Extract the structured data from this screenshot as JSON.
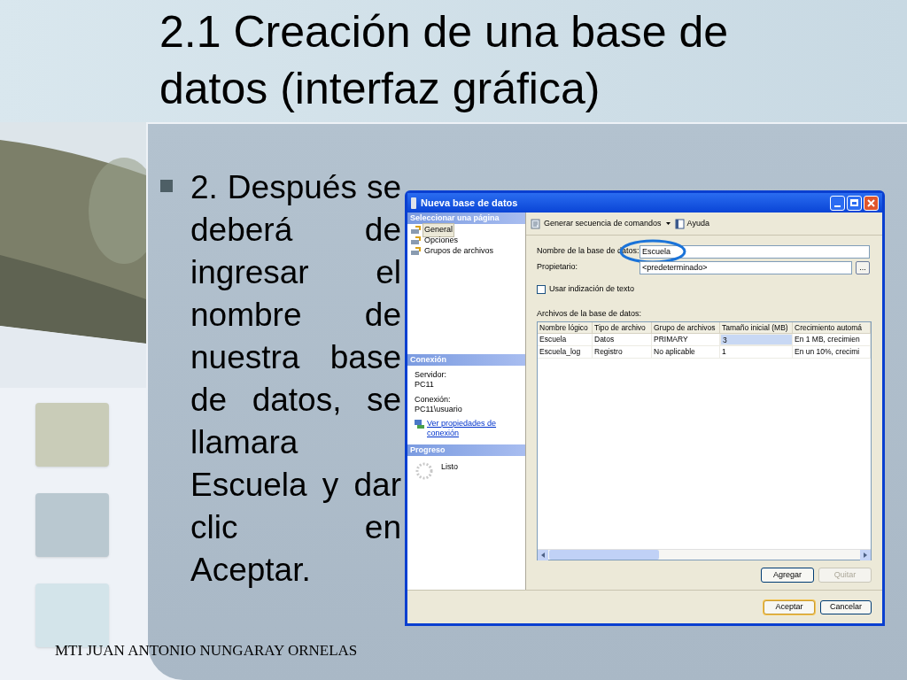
{
  "slide": {
    "title": "2.1 Creación de una base de datos (interfaz gráfica)",
    "bullet": "2. Después se deberá de ingresar el nombre de nuestra base de datos, se llamara Escuela y dar clic en Aceptar.",
    "footer": "MTI JUAN ANTONIO NUNGARAY ORNELAS"
  },
  "dialog": {
    "title": "Nueva base de datos",
    "pages_header": "Seleccionar una página",
    "pages": [
      {
        "label": "General",
        "selected": true
      },
      {
        "label": "Opciones",
        "selected": false
      },
      {
        "label": "Grupos de archivos",
        "selected": false
      }
    ],
    "connection": {
      "header": "Conexión",
      "server_label": "Servidor:",
      "server": "PC11",
      "connection_label": "Conexión:",
      "connection": "PC11\\usuario",
      "link": "Ver propiedades de conexión"
    },
    "progress": {
      "header": "Progreso",
      "status": "Listo"
    },
    "script_button": "Generar secuencia de comandos",
    "help_button": "Ayuda",
    "fields": [
      {
        "label": "Nombre de la base de datos:",
        "value": "Escuela"
      },
      {
        "label": "Propietario:",
        "value": "<predeterminado>",
        "browse_button": "..."
      }
    ],
    "fulltext": {
      "label": "Usar indización de texto",
      "checked": false
    },
    "files": {
      "label": "Archivos de la base de datos:",
      "columns": [
        "Nombre lógico",
        "Tipo de archivo",
        "Grupo de archivos",
        "Tamaño inicial (MB)",
        "Crecimiento automá"
      ],
      "rows": [
        {
          "cells": [
            {
              "text": "Escuela",
              "selected": false
            },
            {
              "text": "Datos",
              "selected": false
            },
            {
              "text": "PRIMARY",
              "selected": false
            },
            {
              "text": "3",
              "selected": true
            },
            {
              "text": "En 1 MB, crecimien",
              "selected": false
            }
          ]
        },
        {
          "cells": [
            {
              "text": "Escuela_log",
              "selected": false
            },
            {
              "text": "Registro",
              "selected": false
            },
            {
              "text": "No aplicable",
              "selected": false
            },
            {
              "text": "1",
              "selected": false
            },
            {
              "text": "En un 10%, crecimi",
              "selected": false
            }
          ]
        }
      ]
    },
    "grid_buttons": [
      {
        "label": "Agregar",
        "disabled": false
      },
      {
        "label": "Quitar",
        "disabled": true
      }
    ],
    "buttons": [
      {
        "label": "Aceptar",
        "default": true
      },
      {
        "label": "Cancelar",
        "default": false
      }
    ]
  }
}
